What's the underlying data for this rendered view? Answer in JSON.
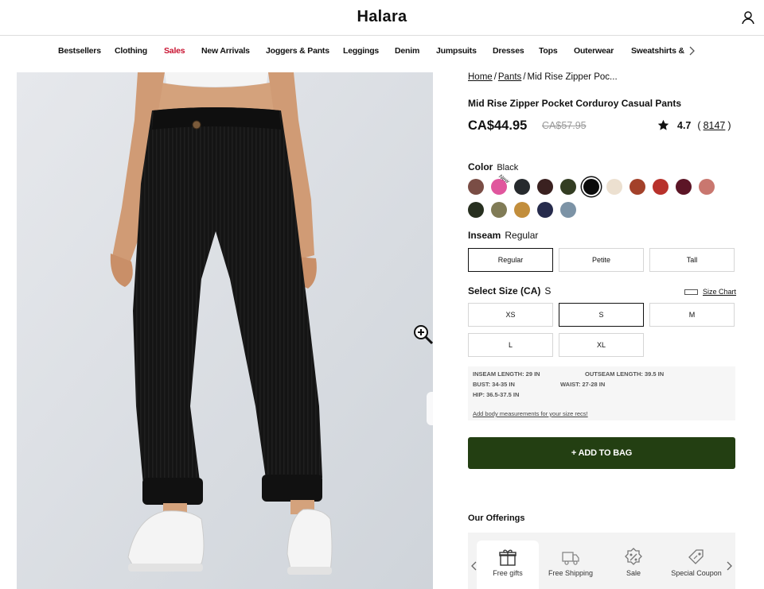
{
  "header": {
    "logo": "Halara",
    "account_icon": "user-icon"
  },
  "nav": {
    "items": [
      {
        "label": "Bestsellers",
        "sale": false
      },
      {
        "label": "Clothing",
        "sale": false
      },
      {
        "label": "Sales",
        "sale": true
      },
      {
        "label": "New Arrivals",
        "sale": false
      },
      {
        "label": "Joggers & Pants",
        "sale": false
      },
      {
        "label": "Leggings",
        "sale": false
      },
      {
        "label": "Denim",
        "sale": false
      },
      {
        "label": "Jumpsuits",
        "sale": false
      },
      {
        "label": "Dresses",
        "sale": false
      },
      {
        "label": "Tops",
        "sale": false
      },
      {
        "label": "Outerwear",
        "sale": false
      },
      {
        "label": "Sweatshirts &",
        "sale": false
      }
    ],
    "sale_color": "#c8102e"
  },
  "breadcrumb": {
    "home": "Home",
    "category": "Pants",
    "current": "Mid Rise Zipper Poc..."
  },
  "product": {
    "title": "Mid Rise Zipper Pocket Corduroy Casual Pants",
    "price": "CA$44.95",
    "old_price": "CA$57.95",
    "rating": "4.7",
    "review_count": "8147",
    "rating_open": "(",
    "rating_close": ")"
  },
  "color": {
    "label": "Color",
    "selected": "Black",
    "new_tag": "New",
    "swatches": [
      "#7a4d45",
      "#e0569d",
      "#262a2d",
      "#3a2120",
      "#333d22",
      "#0b0b0b",
      "#ece0d0",
      "#a3412a",
      "#b8312b",
      "#5c1526",
      "#c9776f",
      "#272f1f",
      "#807b56",
      "#c28e3c",
      "#262b4c",
      "#7c93a6"
    ],
    "selected_index": 5
  },
  "inseam": {
    "label": "Inseam",
    "selected": "Regular",
    "options": [
      "Regular",
      "Petite",
      "Tall"
    ],
    "selected_index": 0
  },
  "size": {
    "label": "Select Size (CA)",
    "selected": "S",
    "size_chart": "Size Chart",
    "options": [
      "XS",
      "S",
      "M",
      "L",
      "XL"
    ],
    "selected_index": 1
  },
  "measurements": {
    "inseam": "INSEAM LENGTH: 29  IN",
    "outseam": "OUTSEAM LENGTH: 39.5  IN",
    "bust": "BUST: 34-35  IN",
    "waist": "WAIST: 27-28  IN",
    "hip": "HIP: 36.5-37.5  IN",
    "link": "Add body measurements for your size recs!"
  },
  "add_to_bag": "+ ADD TO BAG",
  "offerings": {
    "title": "Our Offerings",
    "items": [
      {
        "label": "Free gifts",
        "icon": "gift-icon"
      },
      {
        "label": "Free Shipping",
        "icon": "truck-icon"
      },
      {
        "label": "Sale",
        "icon": "percent-icon"
      },
      {
        "label": "Special Coupon",
        "icon": "coupon-icon"
      }
    ]
  },
  "colors": {
    "brand_green": "#233f12",
    "black": "#111111"
  }
}
